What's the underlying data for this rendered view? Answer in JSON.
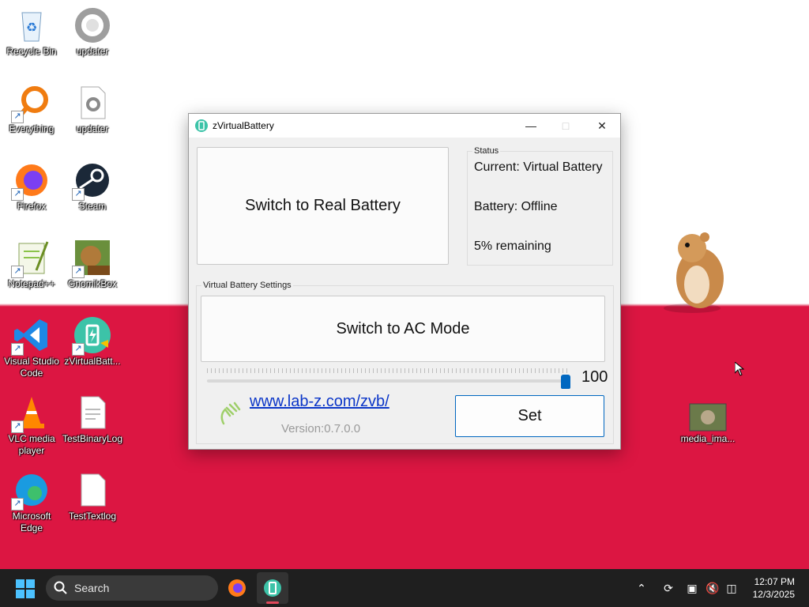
{
  "desktop_icons": [
    {
      "label": "Recycle Bin"
    },
    {
      "label": "updater"
    },
    {
      "label": "Everything"
    },
    {
      "label": "updater"
    },
    {
      "label": "Firefox"
    },
    {
      "label": "Steam"
    },
    {
      "label": "Notepad++"
    },
    {
      "label": "GnomikBox"
    },
    {
      "label": "Visual Studio Code"
    },
    {
      "label": "zVirtualBatt..."
    },
    {
      "label": "VLC media player"
    },
    {
      "label": "TestBinaryLog"
    },
    {
      "label": "Microsoft Edge"
    },
    {
      "label": "TestTextlog"
    },
    {
      "label": "media_ima..."
    }
  ],
  "window": {
    "title": "zVirtualBattery",
    "switch_battery_label": "Switch to Real Battery",
    "status": {
      "legend": "Status",
      "current": "Current: Virtual Battery",
      "battery": "Battery: Offline",
      "remaining": "5% remaining"
    },
    "settings": {
      "legend": "Virtual Battery Settings",
      "ac_mode_label": "Switch to AC Mode",
      "slider_value": "100",
      "slider_fraction": 1.0,
      "set_label": "Set"
    },
    "link_text": "www.lab-z.com/zvb/",
    "version": "Version:0.7.0.0"
  },
  "taskbar": {
    "search_placeholder": "Search",
    "time": "12:07 PM",
    "date": "12/3/2025"
  },
  "colors": {
    "desktop_red": "#dc1642",
    "accent": "#0067c0",
    "link": "#0b36c8",
    "taskbar": "#1f1f1f"
  }
}
